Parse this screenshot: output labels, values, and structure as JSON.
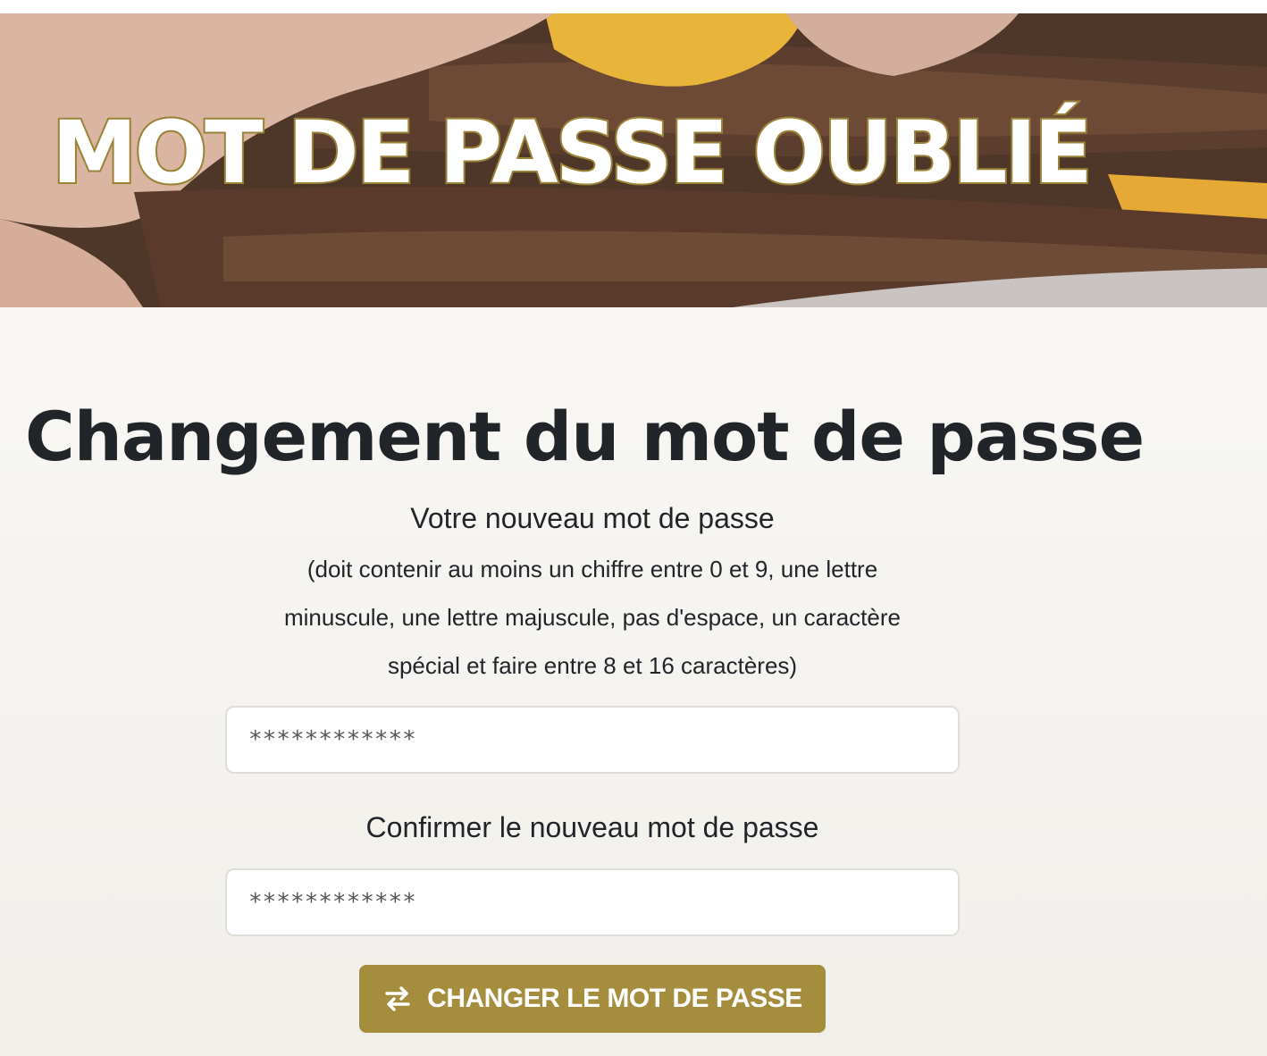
{
  "hero": {
    "title": "MOT DE PASSE OUBLIÉ"
  },
  "main": {
    "page_title": "Changement du mot de passe",
    "new_password": {
      "label": "Votre nouveau mot de passe",
      "hint": "(doit contenir au moins un chiffre entre 0 et 9, une lettre minuscule, une lettre majuscule, pas d'espace, un caractère spécial et faire entre 8 et 16 caractères)",
      "value": "************"
    },
    "confirm_password": {
      "label": "Confirmer le nouveau mot de passe",
      "value": "************"
    },
    "submit": {
      "label": "CHANGER LE MOT DE PASSE",
      "icon": "swap-arrows-icon"
    }
  },
  "colors": {
    "accent": "#a58d3e",
    "title_outline": "#9a8337",
    "text": "#212529"
  }
}
